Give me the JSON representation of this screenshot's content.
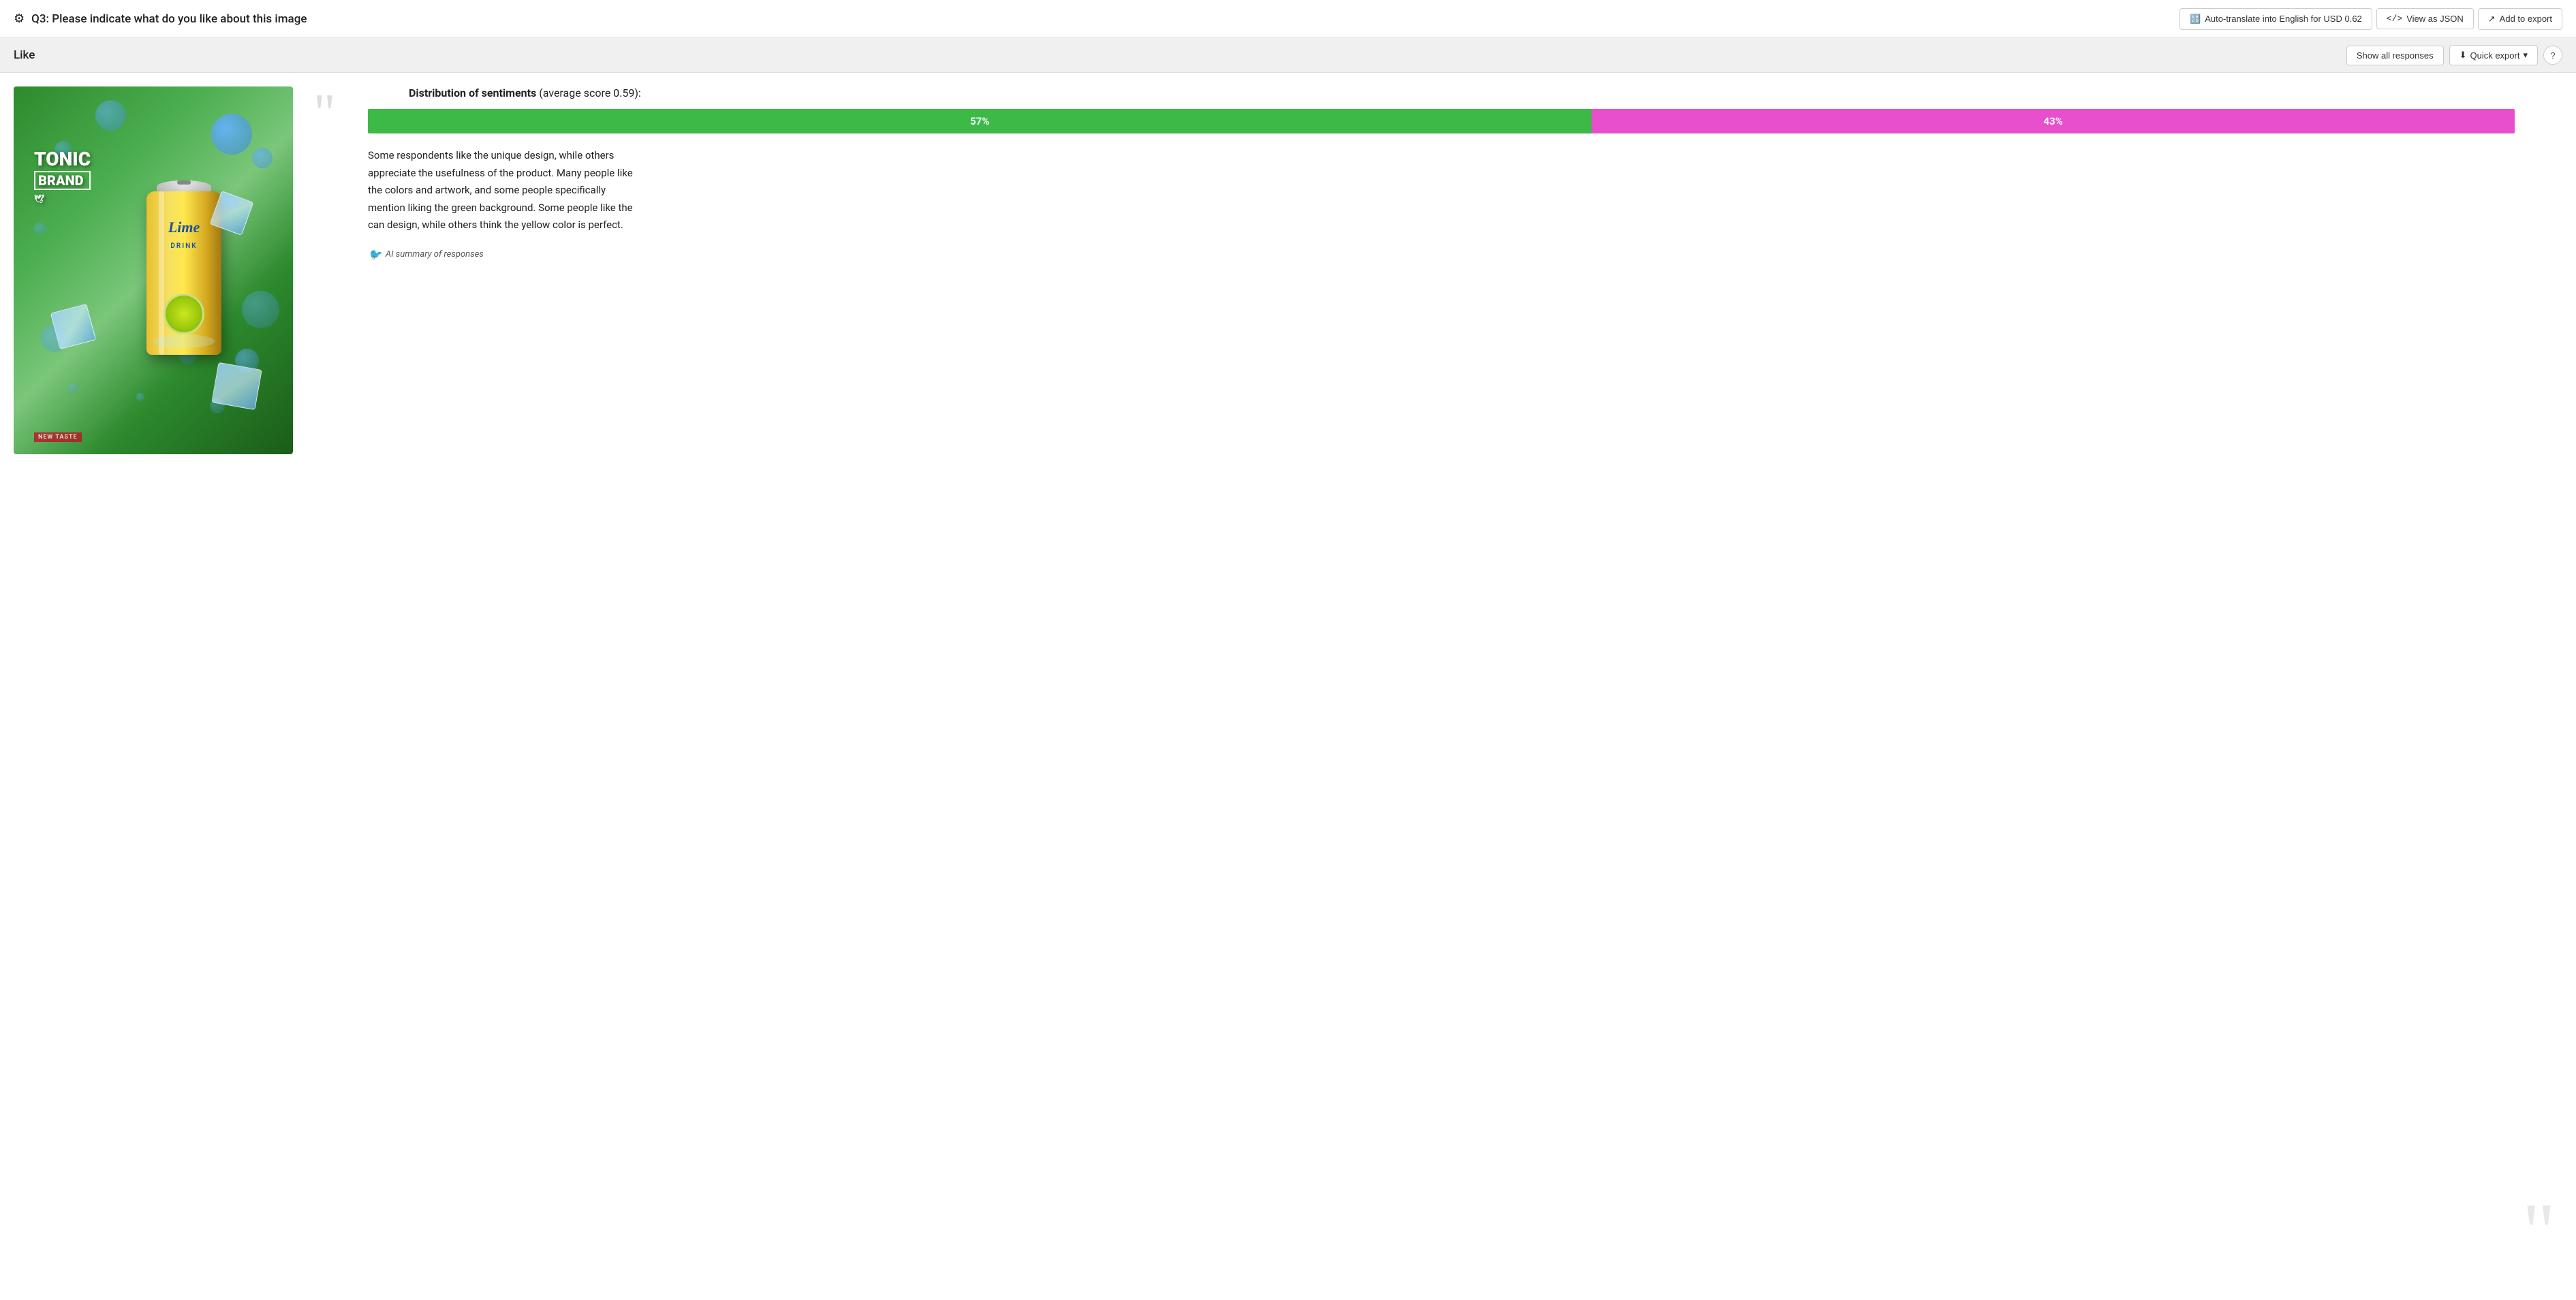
{
  "header": {
    "question_icon": "⚙",
    "question_label": "Q3: Please indicate what do you like about this image",
    "autotranslate_label": "Auto-translate into English for USD 0.62",
    "autotranslate_icon": "🔠",
    "view_json_label": "</> View as JSON",
    "view_json_icon": "</>",
    "add_export_label": "Add to export",
    "add_export_icon": "↗"
  },
  "subheader": {
    "section_label": "Like",
    "show_responses_label": "Show all responses",
    "quick_export_label": "Quick export",
    "quick_export_icon": "⬇",
    "help_label": "?"
  },
  "distribution": {
    "title": "Distribution of sentiments",
    "subtitle": "(average score 0.59):",
    "positive_pct": "57%",
    "negative_pct": "43%",
    "positive_color": "#3cb946",
    "negative_color": "#e84fcc",
    "positive_value": 57,
    "negative_value": 43
  },
  "summary": {
    "text": "Some respondents like the unique design, while others appreciate the usefulness of the product. Many people like the colors and artwork, and some people specifically mention liking the green background. Some people like the can design, while others think the yellow color is perfect.",
    "ai_label": "AI summary of responses",
    "ai_icon": "🐦"
  },
  "image": {
    "alt": "Tonic Brand Lime Drink can advertisement",
    "brand_line1": "TONIC",
    "brand_line2": "BRAND",
    "can_label": "Lime",
    "can_sublabel": "DRINK"
  }
}
